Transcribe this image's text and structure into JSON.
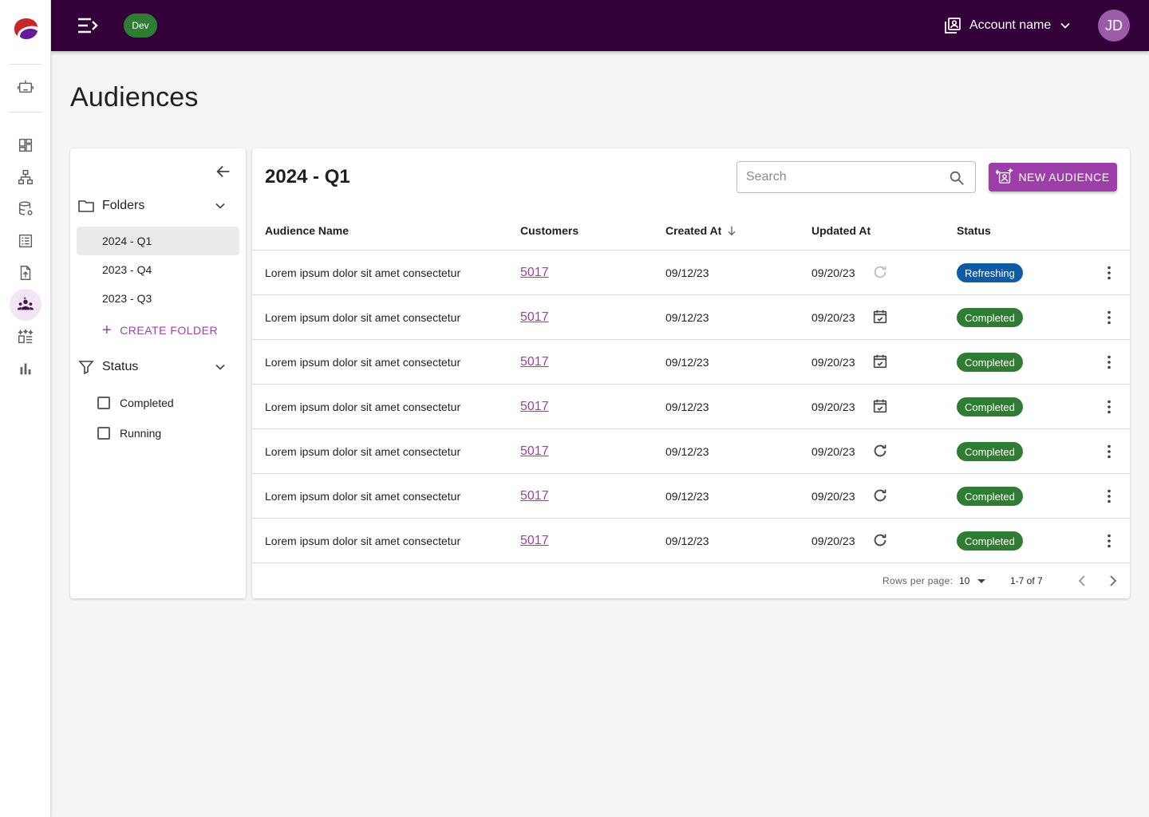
{
  "topbar": {
    "env_badge": "Dev",
    "account_name": "Account name",
    "avatar_initials": "JD",
    "background": "#33003a"
  },
  "page": {
    "title": "Audiences"
  },
  "rail": {
    "items": [
      {
        "icon": "robot-icon"
      },
      {
        "icon": "dashboard-icon"
      },
      {
        "icon": "hierarchy-icon"
      },
      {
        "icon": "database-settings-icon"
      },
      {
        "icon": "list-icon"
      },
      {
        "icon": "file-upload-icon"
      },
      {
        "icon": "audience-icon",
        "active": true
      },
      {
        "icon": "sparkle-list-icon"
      },
      {
        "icon": "bar-chart-icon"
      }
    ]
  },
  "folders": {
    "heading": "Folders",
    "items": [
      {
        "label": "2024 - Q1",
        "selected": true
      },
      {
        "label": "2023 - Q4"
      },
      {
        "label": "2023 - Q3"
      }
    ],
    "create_label": "CREATE FOLDER"
  },
  "status_filter": {
    "heading": "Status",
    "options": [
      {
        "label": "Completed",
        "checked": false
      },
      {
        "label": "Running",
        "checked": false
      }
    ]
  },
  "table": {
    "title": "2024 - Q1",
    "search_placeholder": "Search",
    "new_button": "NEW AUDIENCE",
    "columns": [
      "Audience Name",
      "Customers",
      "Created At",
      "Updated At",
      "Status"
    ],
    "sorted_column": "Created At",
    "rows": [
      {
        "name": "Lorem ipsum dolor sit amet consectetur",
        "customers": "5017",
        "created": "09/12/23",
        "updated": "09/20/23",
        "update_icon": "refresh-disabled-icon",
        "status": "Refreshing"
      },
      {
        "name": "Lorem ipsum dolor sit amet consectetur",
        "customers": "5017",
        "created": "09/12/23",
        "updated": "09/20/23",
        "update_icon": "calendar-check-icon",
        "status": "Completed"
      },
      {
        "name": "Lorem ipsum dolor sit amet consectetur",
        "customers": "5017",
        "created": "09/12/23",
        "updated": "09/20/23",
        "update_icon": "calendar-check-icon",
        "status": "Completed"
      },
      {
        "name": "Lorem ipsum dolor sit amet consectetur",
        "customers": "5017",
        "created": "09/12/23",
        "updated": "09/20/23",
        "update_icon": "calendar-check-icon",
        "status": "Completed"
      },
      {
        "name": "Lorem ipsum dolor sit amet consectetur",
        "customers": "5017",
        "created": "09/12/23",
        "updated": "09/20/23",
        "update_icon": "refresh-icon",
        "status": "Completed"
      },
      {
        "name": "Lorem ipsum dolor sit amet consectetur",
        "customers": "5017",
        "created": "09/12/23",
        "updated": "09/20/23",
        "update_icon": "refresh-icon",
        "status": "Completed"
      },
      {
        "name": "Lorem ipsum dolor sit amet consectetur",
        "customers": "5017",
        "created": "09/12/23",
        "updated": "09/20/23",
        "update_icon": "refresh-icon",
        "status": "Completed"
      }
    ],
    "status_colors": {
      "Refreshing": "#0d5aa7",
      "Completed": "#2e7d32"
    },
    "pagination": {
      "rows_per_page_label": "Rows per page:",
      "rows_per_page": "10",
      "range": "1-7 of 7"
    }
  },
  "colors": {
    "accent": "#9c3fa8",
    "topbar": "#33003a"
  }
}
